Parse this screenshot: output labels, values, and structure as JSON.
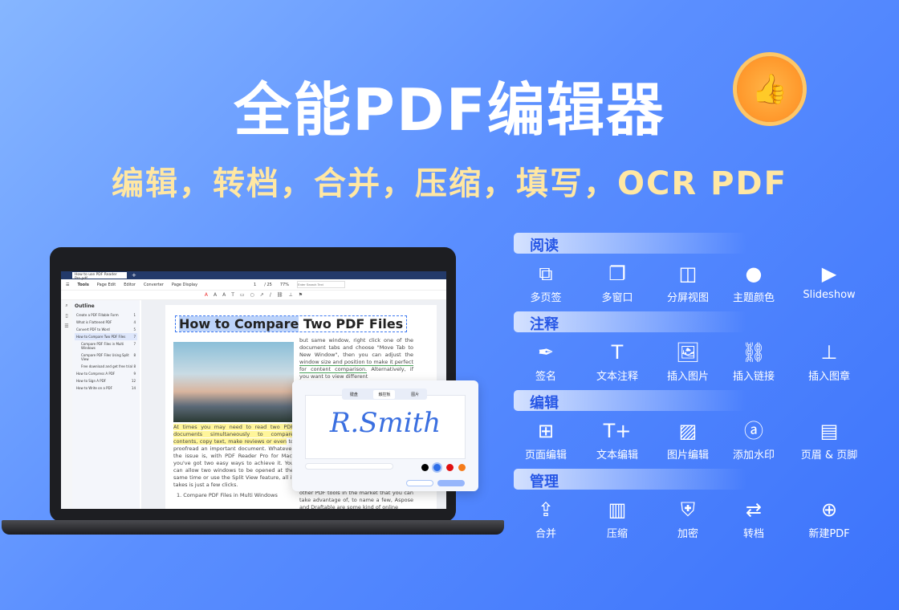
{
  "hero": {
    "title": "全能PDF编辑器",
    "subtitle": "编辑，转档，合并，压缩，填写，OCR PDF",
    "badge_icon": "thumbs-up-icon"
  },
  "app": {
    "tab_title": "How to use PDF Reader Pro.pdf",
    "toolbar": {
      "tools": "Tools",
      "page_edit": "Page Edit",
      "editor": "Editor",
      "converter": "Converter",
      "page_display": "Page Display",
      "page_current": "1",
      "page_total": "/ 25",
      "zoom": "77%",
      "search_placeholder": "Enter Search Text"
    },
    "outline": {
      "title": "Outline",
      "items": [
        {
          "label": "Create a PDF Fillable Form",
          "page": "1"
        },
        {
          "label": "What is Flattened PDF",
          "page": "4"
        },
        {
          "label": "Convert PDF to Word",
          "page": "5"
        },
        {
          "label": "How to Compare Two PDF Files",
          "page": "7",
          "selected": true
        },
        {
          "label": "Compare PDF Files in Multi Windows",
          "page": "7"
        },
        {
          "label": "Compare PDF Files Using Split View",
          "page": "8"
        },
        {
          "label": "Free download and get free trial",
          "page": "8"
        },
        {
          "label": "How to Compress A PDF",
          "page": "9"
        },
        {
          "label": "How to Sign A PDF",
          "page": "12"
        },
        {
          "label": "How to Write on a PDF",
          "page": "14"
        }
      ]
    },
    "document": {
      "title_selected": "How to Compare",
      "title_rest": " Two PDF Files",
      "right_col_1": "but same window, right click one of the document tabs and choose \"Move Tab to New Window\", then you can adjust the",
      "right_col_ul": "window size and position to make it perfect for content comparison.",
      "right_col_2": "Alternatively, if you want to view different",
      "right_col_3": "other PDF tools in the market that you can take advantage of, to name a few, Aspose and Draftable are some kind of online",
      "left_hl": "At times you may need to read two PDF documents simultaneously to compare contents, copy text, make reviews or even",
      "left_rest": "to proofread an important document. Whatever the issue is, with PDF Reader Pro for Mac, you've got two easy ways to achieve it. You can allow two windows to be opened at the same time or use the Split View feature, all it takes is just a few clicks.",
      "list_item": "1. Compare PDF Files in Multi Windows"
    },
    "signature": {
      "tabs": [
        "键盘",
        "触控板",
        "图片"
      ],
      "active_tab": "触控板",
      "signature_text": "R.Smith",
      "colors": [
        "#000000",
        "#2f6fe8",
        "#e01010",
        "#f57c1a"
      ],
      "selected_color": "#2f6fe8"
    }
  },
  "features": [
    {
      "section": "阅读",
      "items": [
        {
          "label": "多页签",
          "icon": "multi-tab-icon"
        },
        {
          "label": "多窗口",
          "icon": "multi-window-icon"
        },
        {
          "label": "分屏视图",
          "icon": "split-view-icon"
        },
        {
          "label": "主题颜色",
          "icon": "theme-color-icon"
        },
        {
          "label": "Slideshow",
          "icon": "slideshow-icon"
        }
      ]
    },
    {
      "section": "注释",
      "items": [
        {
          "label": "签名",
          "icon": "pen-sign-icon"
        },
        {
          "label": "文本注释",
          "icon": "text-icon"
        },
        {
          "label": "插入图片",
          "icon": "image-icon"
        },
        {
          "label": "插入链接",
          "icon": "link-icon"
        },
        {
          "label": "插入图章",
          "icon": "stamp-icon"
        }
      ]
    },
    {
      "section": "编辑",
      "items": [
        {
          "label": "页面编辑",
          "icon": "grid-icon"
        },
        {
          "label": "文本编辑",
          "icon": "text-add-icon"
        },
        {
          "label": "图片编辑",
          "icon": "image-add-icon"
        },
        {
          "label": "添加水印",
          "icon": "watermark-icon"
        },
        {
          "label": "页眉 & 页脚",
          "icon": "header-footer-icon"
        }
      ]
    },
    {
      "section": "管理",
      "items": [
        {
          "label": "合并",
          "icon": "merge-icon"
        },
        {
          "label": "压缩",
          "icon": "compress-icon"
        },
        {
          "label": "加密",
          "icon": "shield-icon"
        },
        {
          "label": "转档",
          "icon": "convert-icon"
        },
        {
          "label": "新建PDF",
          "icon": "new-pdf-icon"
        }
      ]
    }
  ]
}
